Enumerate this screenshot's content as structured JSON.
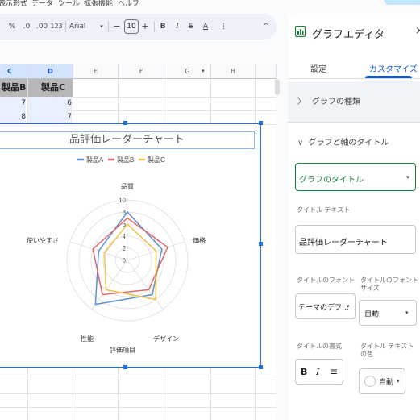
{
  "menu": [
    "表示形式",
    "データ",
    "ツール",
    "拡張機能",
    "ヘルプ"
  ],
  "toolbar": {
    "percent": "%",
    "decrease_decimal": ".0",
    "increase_decimal": ".00",
    "number_format": "123",
    "font": "Arial",
    "minus": "−",
    "font_size": "10",
    "plus": "+",
    "bold": "B",
    "italic": "I",
    "strikethrough": "S",
    "text_color": "A",
    "more": "⋮",
    "collapse": "^"
  },
  "columns": [
    "C",
    "D",
    "E",
    "F",
    "G",
    "H"
  ],
  "table": {
    "headers": [
      "製品B",
      "製品C"
    ],
    "rows": [
      [
        "7",
        "6"
      ],
      [
        "8",
        "7"
      ]
    ]
  },
  "chart_data": {
    "type": "radar",
    "title": "品評価レーダーチャート",
    "axis_title": "評価項目",
    "categories": [
      "品質",
      "価格",
      "デザイン",
      "評価項目",
      "性能",
      "使いやすさ"
    ],
    "radar_spokes": [
      "品質",
      "価格",
      "デザイン",
      "性能",
      "使いやすさ"
    ],
    "r_ticks": [
      "0",
      "2",
      "4",
      "6",
      "8",
      "10"
    ],
    "r_range": [
      0,
      10
    ],
    "series": [
      {
        "name": "製品A",
        "color": "#5b8fd6",
        "values": [
          8,
          6,
          7,
          9,
          5
        ]
      },
      {
        "name": "製品B",
        "color": "#e26a6a",
        "values": [
          7,
          7,
          6,
          7,
          6
        ]
      },
      {
        "name": "製品C",
        "color": "#f0c14b",
        "values": [
          6,
          5,
          8,
          6,
          4
        ]
      }
    ],
    "legend_position": "top"
  },
  "panel": {
    "title": "グラフエディタ",
    "close": "×",
    "tabs": [
      "設定",
      "カスタマイズ"
    ],
    "active_tab": "カスタマイズ",
    "sections": {
      "chart_type": "グラフの種類",
      "titles": "グラフと軸のタイトル"
    },
    "title_selector": "グラフのタイトル",
    "title_text_label": "タイトル テキスト",
    "title_text_value": "品評価レーダーチャート",
    "font_label": "タイトルのフォント",
    "font_value": "テーマのデフ...",
    "font_size_label": "タイトルのフォントサイズ",
    "font_size_value": "自動",
    "format_label": "タイトルの書式",
    "color_label": "タイトル テキストの色",
    "color_value": "自動",
    "format_bold": "B",
    "format_italic": "I",
    "format_align": "≡"
  }
}
